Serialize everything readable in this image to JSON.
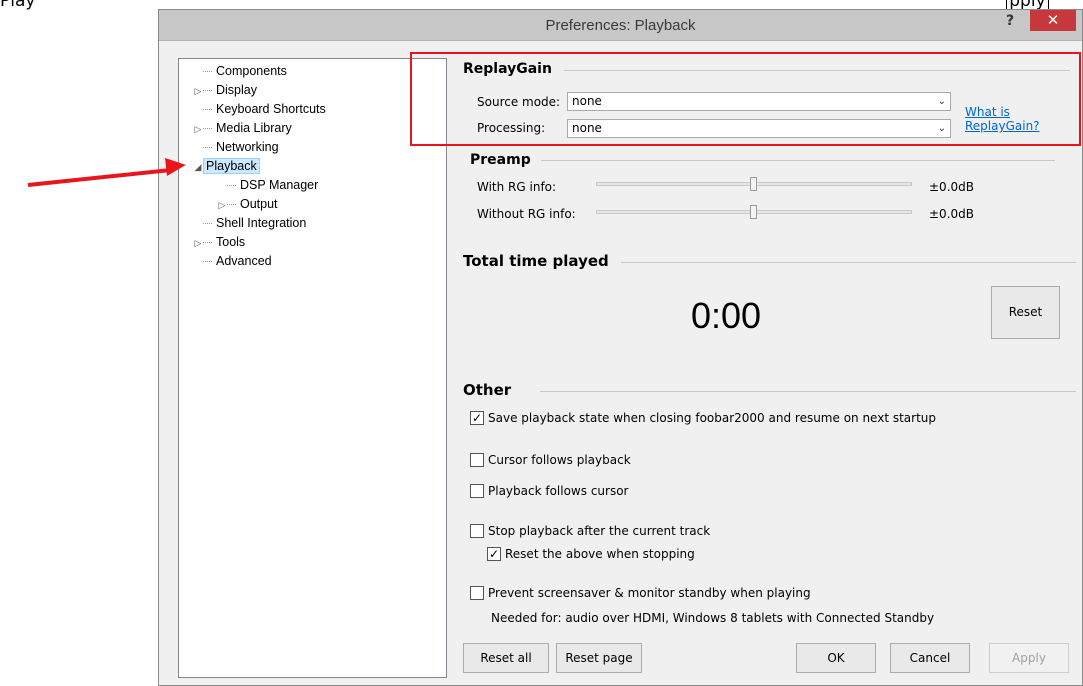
{
  "caption": {
    "text_prefix": "Play",
    "text_boxed": "pply"
  },
  "window": {
    "title": "Preferences: Playback",
    "help_glyph": "?",
    "close_glyph": "✕"
  },
  "tree": {
    "items": [
      {
        "label": "Components",
        "expander": ""
      },
      {
        "label": "Display",
        "expander": "▷"
      },
      {
        "label": "Keyboard Shortcuts",
        "expander": ""
      },
      {
        "label": "Media Library",
        "expander": "▷"
      },
      {
        "label": "Networking",
        "expander": ""
      },
      {
        "label": "Playback",
        "expander": "◢"
      },
      {
        "label": "DSP Manager",
        "expander": ""
      },
      {
        "label": "Output",
        "expander": "▷"
      },
      {
        "label": "Shell Integration",
        "expander": ""
      },
      {
        "label": "Tools",
        "expander": "▷"
      },
      {
        "label": "Advanced",
        "expander": ""
      }
    ]
  },
  "replaygain": {
    "heading": "ReplayGain",
    "source_mode_label": "Source mode:",
    "source_mode_value": "none",
    "processing_label": "Processing:",
    "processing_value": "none",
    "link_line1": "What is",
    "link_line2": "ReplayGain?"
  },
  "preamp": {
    "heading": "Preamp",
    "with_rg_label": "With RG info:",
    "with_rg_value": "±0.0dB",
    "without_rg_label": "Without RG info:",
    "without_rg_value": "±0.0dB"
  },
  "total_time": {
    "heading": "Total time played",
    "value": "0:00",
    "reset_label": "Reset"
  },
  "other": {
    "heading": "Other",
    "save_state": {
      "label": "Save playback state when closing foobar2000 and resume on next startup",
      "checked": true
    },
    "cursor_follows": {
      "label": "Cursor follows playback",
      "checked": false
    },
    "playback_follows": {
      "label": "Playback follows cursor",
      "checked": false
    },
    "stop_after": {
      "label": "Stop playback after the current track",
      "checked": false
    },
    "reset_above": {
      "label": "Reset the above when stopping",
      "checked": true
    },
    "prevent_screensaver": {
      "label": "Prevent screensaver & monitor standby when playing",
      "checked": false
    },
    "needed_for": "Needed for: audio over HDMI, Windows 8 tablets with Connected Standby"
  },
  "buttons": {
    "reset_all": "Reset all",
    "reset_page": "Reset page",
    "ok": "OK",
    "cancel": "Cancel",
    "apply": "Apply"
  },
  "colors": {
    "annotation_red": "#e8161c",
    "link_blue": "#0066cc",
    "close_red": "#c7383c"
  },
  "checkmark_glyph": "✓"
}
